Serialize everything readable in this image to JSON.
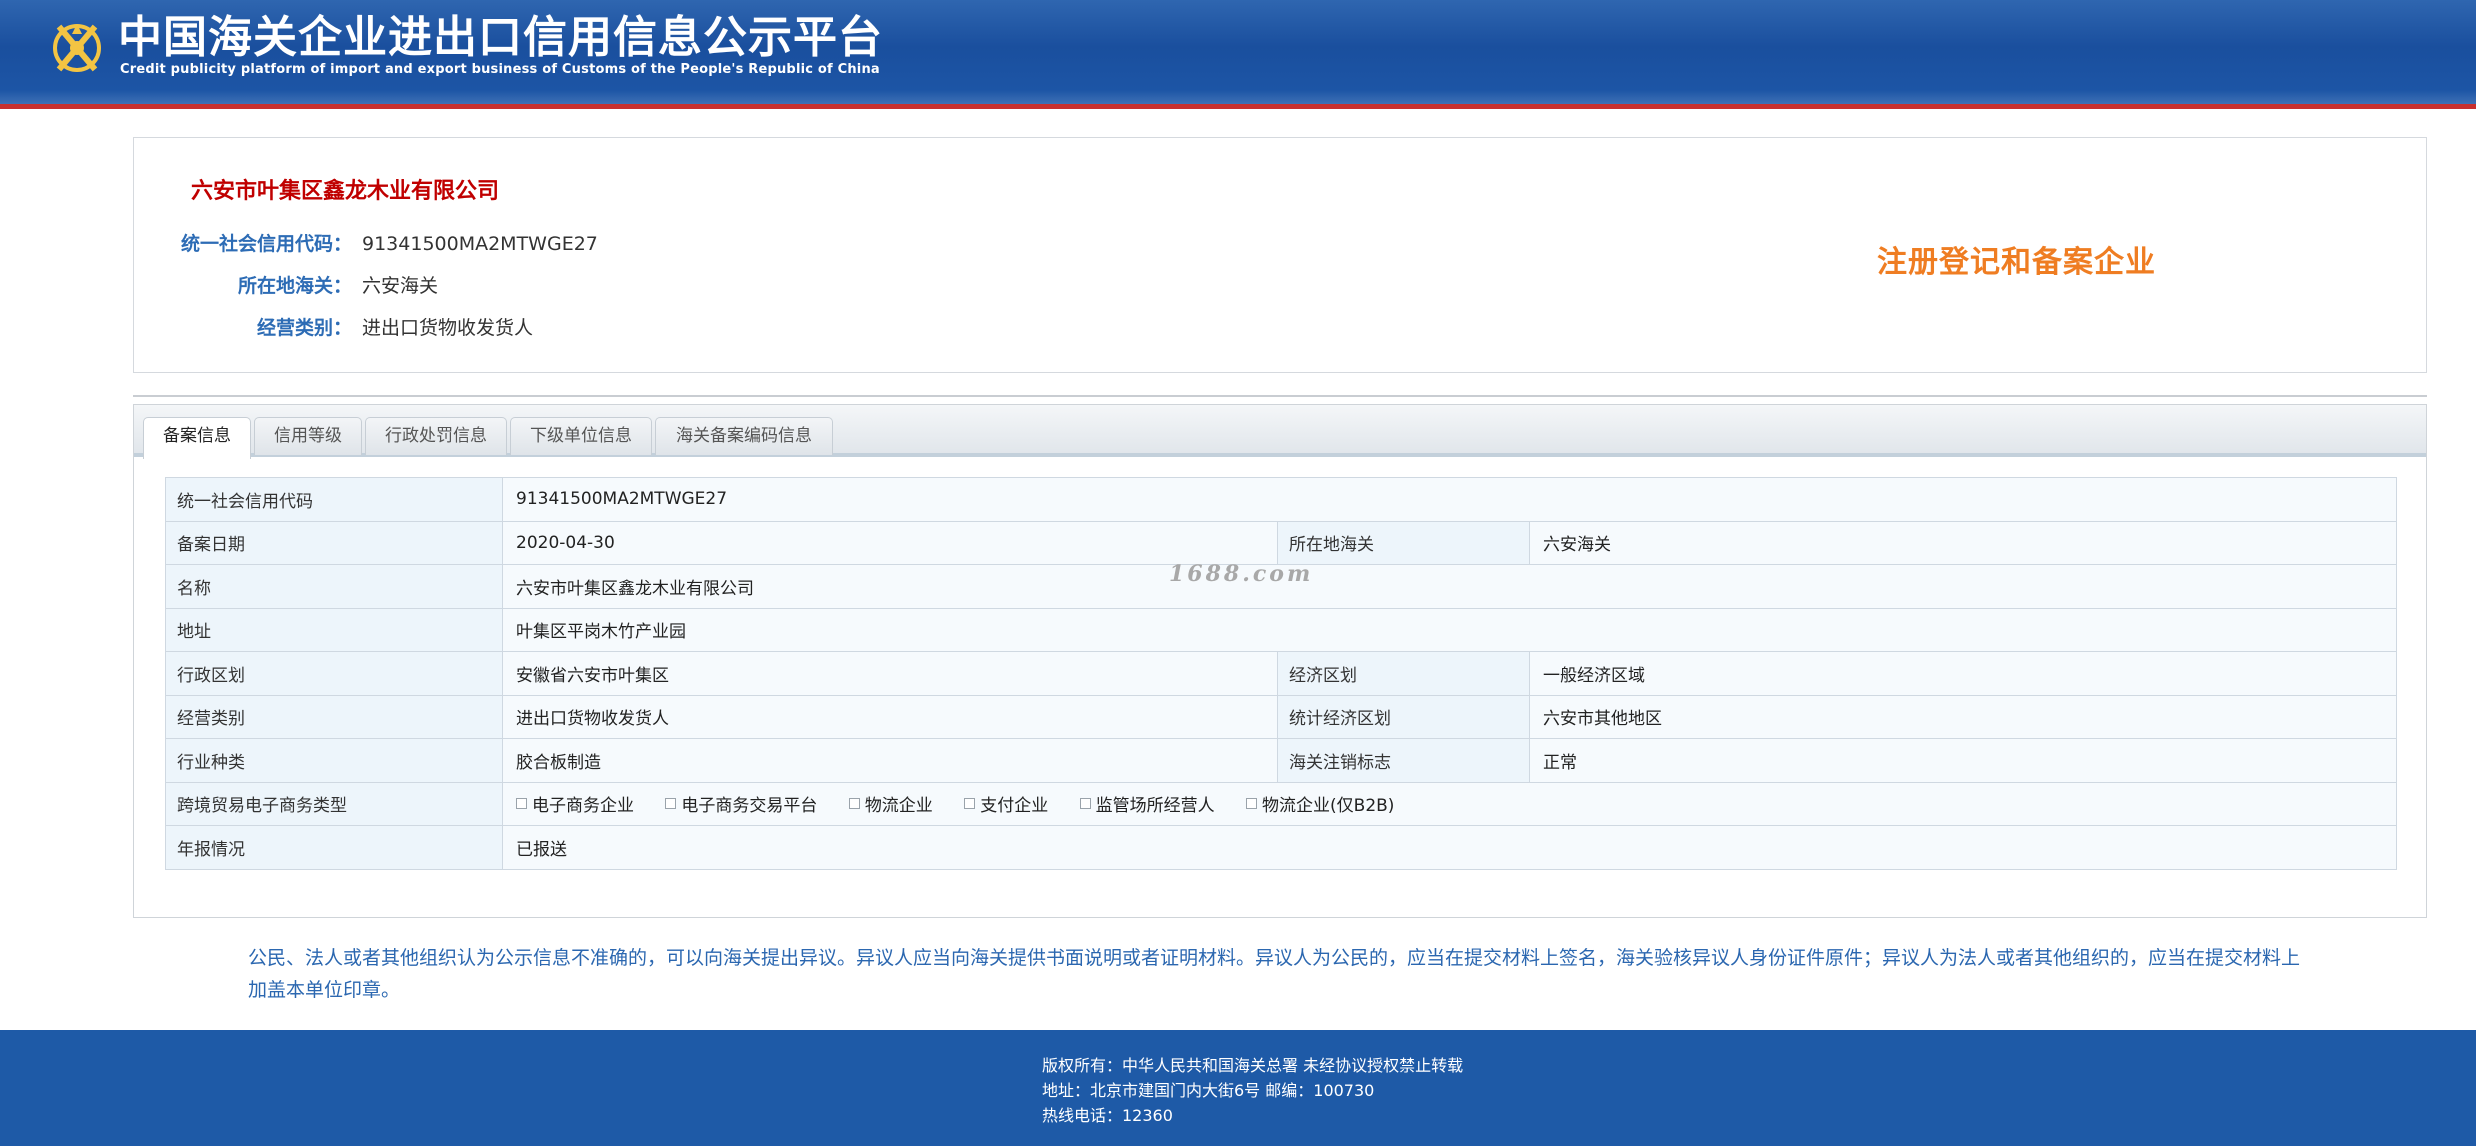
{
  "header": {
    "title": "中国海关企业进出口信用信息公示平台",
    "subtitle": "Credit publicity platform of import and export business of Customs of the People's Republic of China",
    "logo_icon": "customs-emblem-icon",
    "colors": {
      "header_bg": "#1d57a8",
      "accent_line": "#c8302e"
    }
  },
  "company": {
    "name": "六安市叶集区鑫龙木业有限公司",
    "fields": [
      {
        "label": "统一社会信用代码：",
        "value": "91341500MA2MTWGE27"
      },
      {
        "label": "所在地海关：",
        "value": "六安海关"
      },
      {
        "label": "经营类别：",
        "value": "进出口货物收发货人"
      }
    ],
    "status_tag": "注册登记和备案企业"
  },
  "tabs": [
    {
      "label": "备案信息",
      "active": true
    },
    {
      "label": "信用等级",
      "active": false
    },
    {
      "label": "行政处罚信息",
      "active": false
    },
    {
      "label": "下级单位信息",
      "active": false
    },
    {
      "label": "海关备案编码信息",
      "active": false
    }
  ],
  "record": {
    "credit_code_label": "统一社会信用代码",
    "credit_code": "91341500MA2MTWGE27",
    "record_date_label": "备案日期",
    "record_date": "2020-04-30",
    "customs_label": "所在地海关",
    "customs": "六安海关",
    "name_label": "名称",
    "name": "六安市叶集区鑫龙木业有限公司",
    "address_label": "地址",
    "address": "叶集区平岗木竹产业园",
    "admin_region_label": "行政区划",
    "admin_region": "安徽省六安市叶集区",
    "econ_region_label": "经济区划",
    "econ_region": "一般经济区域",
    "business_type_label": "经营类别",
    "business_type": "进出口货物收发货人",
    "stat_region_label": "统计经济区划",
    "stat_region": "六安市其他地区",
    "industry_label": "行业种类",
    "industry": "胶合板制造",
    "cancel_flag_label": "海关注销标志",
    "cancel_flag": "正常",
    "ecommerce_label": "跨境贸易电子商务类型",
    "ecommerce_options": [
      "电子商务企业",
      "电子商务交易平台",
      "物流企业",
      "支付企业",
      "监管场所经营人",
      "物流企业(仅B2B)"
    ],
    "annual_report_label": "年报情况",
    "annual_report": "已报送"
  },
  "watermark": "1688.com",
  "notice": "公民、法人或者其他组织认为公示信息不准确的，可以向海关提出异议。异议人应当向海关提供书面说明或者证明材料。异议人为公民的，应当在提交材料上签名，海关验核异议人身份证件原件；异议人为法人或者其他组织的，应当在提交材料上加盖本单位印章。",
  "footer": {
    "copyright": "版权所有：中华人民共和国海关总署   未经协议授权禁止转载",
    "address": "地址：北京市建国门内大街6号 邮编：100730",
    "hotline": "热线电话：12360"
  }
}
